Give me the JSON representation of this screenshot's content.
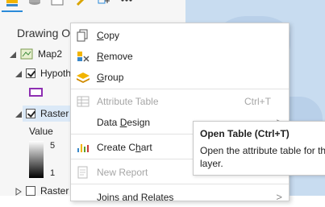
{
  "contents_pane": {
    "title": "Drawing O",
    "tree": {
      "map_label": "Map2",
      "layer1_label": "Hypoth",
      "layer2_label": "Raster",
      "layer3_label": "Raster",
      "legend": {
        "value_label": "Value",
        "high": "5",
        "low": "1"
      }
    },
    "toolbar_icons": [
      "list-by-drawing-order-icon",
      "database-icon",
      "edit-icon",
      "add-icon",
      "more-icon"
    ]
  },
  "context_menu": {
    "items": [
      {
        "label": "Copy",
        "accel": "C",
        "icon": "copy-icon",
        "disabled": false
      },
      {
        "label": "Remove",
        "accel": "R",
        "icon": "remove-icon",
        "disabled": false
      },
      {
        "label": "Group",
        "accel": "G",
        "icon": "group-icon",
        "disabled": false
      },
      {
        "label": "Attribute Table",
        "shortcut": "Ctrl+T",
        "icon": "table-icon",
        "disabled": true
      },
      {
        "label": "Data Design",
        "submenu": true,
        "disabled": false
      },
      {
        "label": "Create Chart",
        "icon": "chart-icon",
        "submenu": true,
        "disabled": false
      },
      {
        "label": "New Report",
        "icon": "report-icon",
        "disabled": true
      },
      {
        "label": "Joins and Relates",
        "submenu": true,
        "disabled": false
      }
    ],
    "submenu_arrow": ">"
  },
  "tooltip": {
    "title": "Open Table (Ctrl+T)",
    "line1": "Open the attribute table for th",
    "line2": "layer."
  },
  "colors": {
    "selection": "#dbe9f7",
    "accent": "#2b8bd9",
    "disabled_text": "#a6a6a6",
    "map_water": "#c8dcf0"
  }
}
